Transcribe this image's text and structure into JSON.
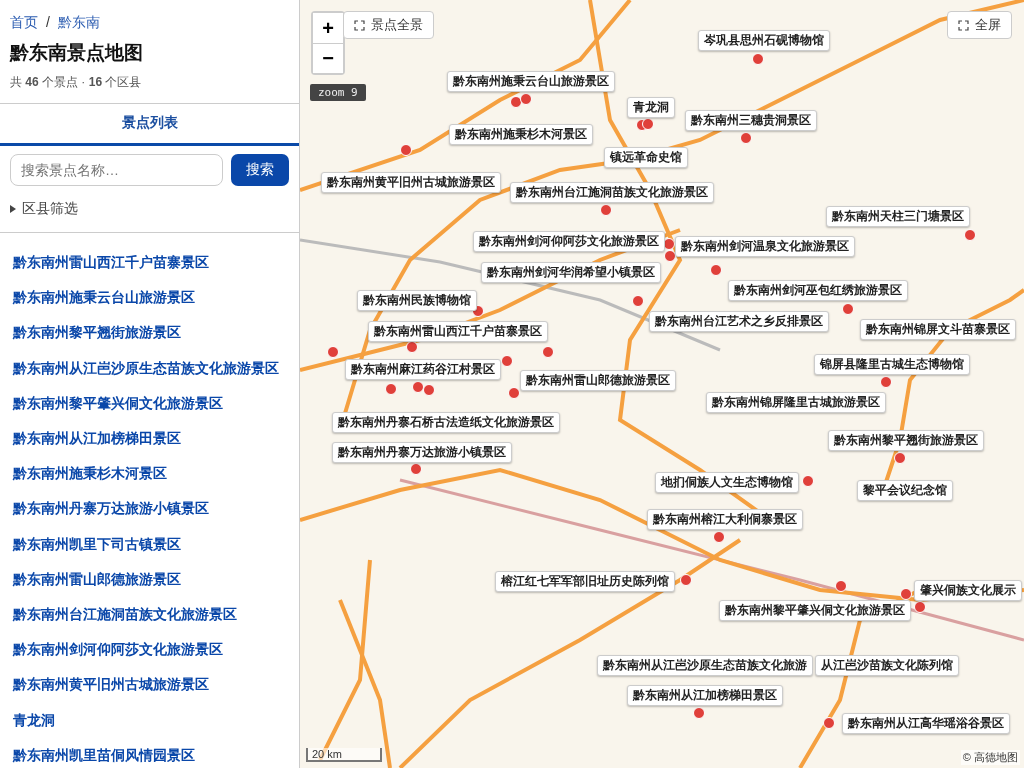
{
  "breadcrumb": {
    "items": [
      "首页",
      "黔东南"
    ],
    "separator": "/"
  },
  "title": "黔东南景点地图",
  "stats": "共 **46** 个景点 · **16** 个区县",
  "tabs": [
    {
      "label": "景点列表",
      "selected": true
    }
  ],
  "search": {
    "placeholder": "搜索景点名称…",
    "button": "搜索"
  },
  "filter": {
    "label": "区县筛选",
    "expanded": false
  },
  "spots": [
    "黔东南州雷山西江千户苗寨景区",
    "黔东南州施秉云台山旅游景区",
    "黔东南州黎平翘街旅游景区",
    "黔东南州从江岜沙原生态苗族文化旅游景区",
    "黔东南州黎平肇兴侗文化旅游景区",
    "黔东南州从江加榜梯田景区",
    "黔东南州施秉杉木河景区",
    "黔东南州丹寨万达旅游小镇景区",
    "黔东南州凯里下司古镇景区",
    "黔东南州雷山郎德旅游景区",
    "黔东南州台江施洞苗族文化旅游景区",
    "黔东南州剑河仰阿莎文化旅游景区",
    "黔东南州黄平旧州古城旅游景区",
    "青龙洞",
    "黔东南州凯里苗侗风情园景区"
  ],
  "map": {
    "zoom_in": "+",
    "zoom_out": "−",
    "overview_button": "景点全景",
    "fullscreen_button": "全屏",
    "zoom_badge": "zoom 9",
    "scale": "20 km",
    "attribution": "© 高德地图",
    "labels": [
      "岑巩县思州石砚博物馆",
      "黔东南州施秉云台山旅游景区",
      "青龙洞",
      "黔东南州施秉杉木河景区",
      "黔东南州三穗贵洞景区",
      "镇远革命史馆",
      "黔东南州黄平旧州古城旅游景区",
      "黔东南州台江施洞苗族文化旅游景区",
      "黔东南州天柱三门塘景区",
      "黔东南州剑河仰阿莎文化旅游景区",
      "黔东南州剑河温泉文化旅游景区",
      "黔东南州剑河华润希望小镇景区",
      "黔东南州民族博物馆",
      "黔东南州剑河巫包红绣旅游景区",
      "黔东南州雷山西江千户苗寨景区",
      "黔东南州台江艺术之乡反排景区",
      "黔东南州锦屏文斗苗寨景区",
      "黔东南州麻江药谷江村景区",
      "黔东南州雷山郎德旅游景区",
      "锦屏县隆里古城生态博物馆",
      "黔东南州锦屏隆里古城旅游景区",
      "黔东南州丹寨石桥古法造纸文化旅游景区",
      "黔东南州丹寨万达旅游小镇景区",
      "黔东南州黎平翘街旅游景区",
      "地扪侗族人文生态博物馆",
      "黎平会议纪念馆",
      "黔东南州榕江大利侗寨景区",
      "榕江红七军军部旧址历史陈列馆",
      "肇兴侗族文化展示",
      "黔东南州黎平肇兴侗文化旅游景区",
      "黔东南州从江岜沙原生态苗族文化旅游",
      "从江岜沙苗族文化陈列馆",
      "黔东南州从江加榜梯田景区",
      "黔东南州从江高华瑶浴谷景区"
    ]
  }
}
